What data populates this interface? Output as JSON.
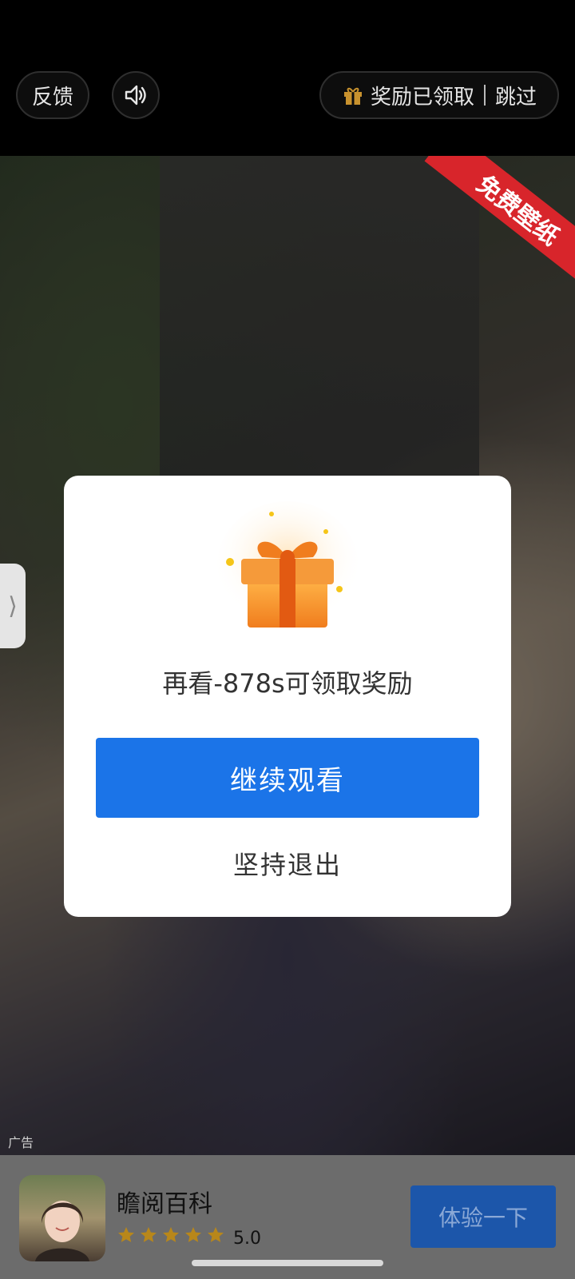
{
  "topbar": {
    "feedback_label": "反馈",
    "sound_icon": "speaker-icon",
    "reward_icon": "gift-icon",
    "reward_status": "奖励已领取",
    "skip_label": "跳过"
  },
  "video": {
    "corner_ribbon": "免费壁纸",
    "side_tab_glyph": "⟩",
    "ad_label": "广告"
  },
  "dialog": {
    "gift_icon": "gift-box-icon",
    "message": "再看-878s可领取奖励",
    "continue_label": "继续观看",
    "quit_label": "坚持退出"
  },
  "adbar": {
    "app_name": "瞻阅百科",
    "rating_value": "5.0",
    "stars": 5,
    "cta_label": "体验一下"
  },
  "colors": {
    "primary": "#1b74e8",
    "star": "#b8871a",
    "ribbon": "#d8252b",
    "gift_orange": "#f08a26"
  }
}
